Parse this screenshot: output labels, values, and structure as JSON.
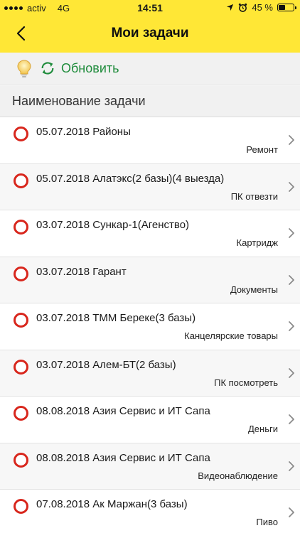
{
  "status_bar": {
    "carrier": "activ",
    "network": "4G",
    "time": "14:51",
    "battery_text": "45 %",
    "battery_level": 0.45,
    "icons": [
      "signal-dots-icon",
      "location-arrow-icon",
      "alarm-clock-icon",
      "battery-icon"
    ]
  },
  "nav": {
    "title": "Мои задачи",
    "back_icon": "chevron-left-icon",
    "background": "#ffe736"
  },
  "toolbar": {
    "bulb_icon": "lightbulb-icon",
    "refresh_icon": "refresh-icon",
    "refresh_label": "Обновить",
    "accent": "#1f8c3c"
  },
  "list": {
    "header": "Наименование задачи",
    "status_color": "#d8261c",
    "items": [
      {
        "title": "05.07.2018 Районы",
        "category": "Ремонт"
      },
      {
        "title": "05.07.2018 Алатэкс(2 базы)(4 выезда)",
        "category": "ПК отвезти"
      },
      {
        "title": "03.07.2018 Сункар-1(Агенство)",
        "category": "Картридж"
      },
      {
        "title": "03.07.2018 Гарант",
        "category": "Документы"
      },
      {
        "title": "03.07.2018 ТММ Береке(3 базы)",
        "category": "Канцелярские товары"
      },
      {
        "title": "03.07.2018 Алем-БТ(2 базы)",
        "category": "ПК посмотреть"
      },
      {
        "title": "08.08.2018 Азия Сервис и ИТ Сапа",
        "category": "Деньги"
      },
      {
        "title": "08.08.2018 Азия Сервис и ИТ Сапа",
        "category": "Видеонаблюдение"
      },
      {
        "title": "07.08.2018 Ак Маржан(3 базы)",
        "category": "Пиво"
      }
    ]
  }
}
